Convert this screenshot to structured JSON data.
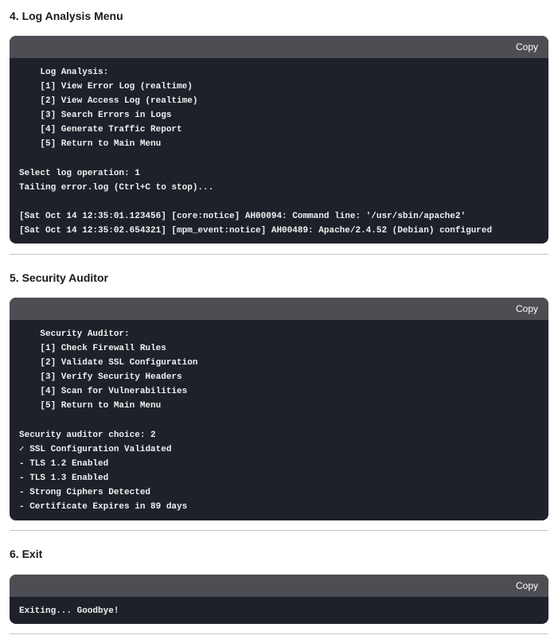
{
  "sections": [
    {
      "heading": "4. Log Analysis Menu",
      "copy_label": "Copy",
      "code": "    Log Analysis:\n    [1] View Error Log (realtime)\n    [2] View Access Log (realtime)\n    [3] Search Errors in Logs\n    [4] Generate Traffic Report\n    [5] Return to Main Menu\n\nSelect log operation: 1\nTailing error.log (Ctrl+C to stop)...\n\n[Sat Oct 14 12:35:01.123456] [core:notice] AH00094: Command line: '/usr/sbin/apache2'\n[Sat Oct 14 12:35:02.654321] [mpm_event:notice] AH00489: Apache/2.4.52 (Debian) configured"
    },
    {
      "heading": "5. Security Auditor",
      "copy_label": "Copy",
      "code": "    Security Auditor:\n    [1] Check Firewall Rules\n    [2] Validate SSL Configuration\n    [3] Verify Security Headers\n    [4] Scan for Vulnerabilities\n    [5] Return to Main Menu\n\nSecurity auditor choice: 2\n✓ SSL Configuration Validated\n- TLS 1.2 Enabled\n- TLS 1.3 Enabled\n- Strong Ciphers Detected\n- Certificate Expires in 89 days"
    },
    {
      "heading": "6. Exit",
      "copy_label": "Copy",
      "code": "Exiting... Goodbye!"
    }
  ]
}
